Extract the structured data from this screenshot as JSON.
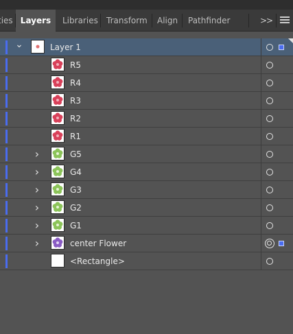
{
  "tabs": [
    {
      "label": "ties",
      "active": false
    },
    {
      "label": "Layers",
      "active": true
    },
    {
      "label": "Libraries",
      "active": false
    },
    {
      "label": "Transform",
      "active": false
    },
    {
      "label": "Align",
      "active": false
    },
    {
      "label": "Pathfinder",
      "active": false
    }
  ],
  "overflow_label": ">>",
  "layer_color": "#4a6cf0",
  "layers": [
    {
      "name": "Layer 1",
      "level": 0,
      "expanded": true,
      "thumb": "layer-thumb",
      "target": "single",
      "selected": true,
      "highlight": true
    },
    {
      "name": "R5",
      "level": 1,
      "thumb": "red-flower",
      "target": "single"
    },
    {
      "name": "R4",
      "level": 1,
      "thumb": "red-flower",
      "target": "single"
    },
    {
      "name": "R3",
      "level": 1,
      "thumb": "red-flower",
      "target": "single"
    },
    {
      "name": "R2",
      "level": 1,
      "thumb": "red-flower",
      "target": "single"
    },
    {
      "name": "R1",
      "level": 1,
      "thumb": "red-flower",
      "target": "single"
    },
    {
      "name": "G5",
      "level": 1,
      "expandable": true,
      "thumb": "green-flower",
      "target": "single"
    },
    {
      "name": "G4",
      "level": 1,
      "expandable": true,
      "thumb": "green-flower",
      "target": "single"
    },
    {
      "name": "G3",
      "level": 1,
      "expandable": true,
      "thumb": "green-flower",
      "target": "single"
    },
    {
      "name": "G2",
      "level": 1,
      "expandable": true,
      "thumb": "green-flower",
      "target": "single"
    },
    {
      "name": "G1",
      "level": 1,
      "expandable": true,
      "thumb": "green-flower",
      "target": "single"
    },
    {
      "name": "center Flower",
      "level": 1,
      "expandable": true,
      "thumb": "purple-flower",
      "target": "double",
      "selected": true
    },
    {
      "name": "<Rectangle>",
      "level": 1,
      "thumb": "white-rect",
      "target": "single"
    }
  ]
}
